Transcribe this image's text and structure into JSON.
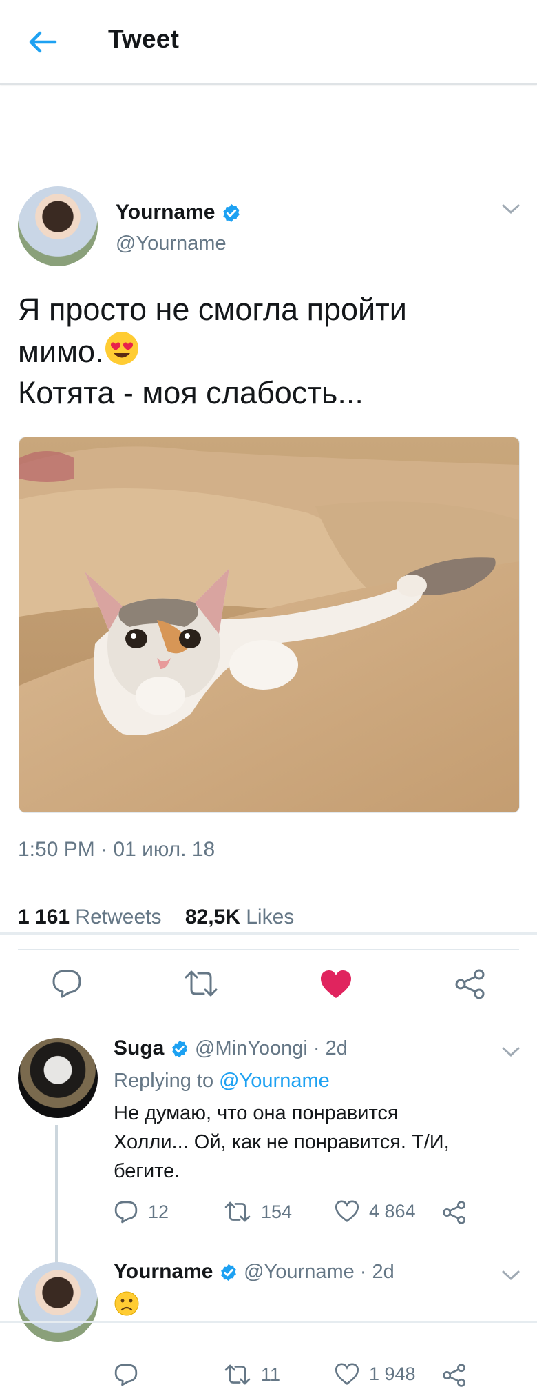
{
  "header": {
    "title": "Tweet"
  },
  "tweet": {
    "name": "Yourname",
    "handle": "@Yourname",
    "text_line1": "Я просто не смогла пройти",
    "text_line2": "мимо.",
    "text_line3": "Котята - моя слабость...",
    "photo_desc_icon": "kitten-photo",
    "timestamp": "1:50 PM · 01 июл. 18",
    "retweets_count": "1 161",
    "retweets_label": "Retweets",
    "likes_count": "82,5K",
    "likes_label": "Likes",
    "liked": true
  },
  "replies": [
    {
      "name": "Suga",
      "handle": "@MinYoongi · 2d",
      "replying_prefix": "Replying to",
      "replying_to": "@Yourname",
      "text_line1": "Не думаю, что она понравится",
      "text_line2": "Холли... Ой, как не понравится. Т/И,",
      "text_line3": "бегите.",
      "reply_count": "12",
      "retweet_count": "154",
      "like_count": "4 864"
    },
    {
      "name": "Yourname",
      "handle": "@Yourname · 2d",
      "emoji": "slightly-frowning-face-icon",
      "retweet_count": "11",
      "like_count": "1 948"
    }
  ],
  "colors": {
    "accent": "#1da1f2",
    "like_red": "#e0245e",
    "muted": "#657786"
  }
}
